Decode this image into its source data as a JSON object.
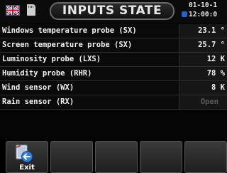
{
  "header": {
    "title": "INPUTS STATE",
    "date": "01-10-1",
    "time": "12:00:0"
  },
  "rows": [
    {
      "name": "Windows temperature probe (SX)",
      "value": "23.1 °",
      "enabled": true
    },
    {
      "name": "Screen temperature probe (SX)",
      "value": "25.7 °",
      "enabled": true
    },
    {
      "name": "Luminosity probe (LXS)",
      "value": "12 K",
      "enabled": true
    },
    {
      "name": "Humidity probe (RHR)",
      "value": "78 %",
      "enabled": true
    },
    {
      "name": "Wind sensor (WX)",
      "value": "8 K",
      "enabled": true
    },
    {
      "name": "Rain sensor (RX)",
      "value": "Open",
      "enabled": false
    }
  ],
  "footer": {
    "exit_label": "Exit"
  },
  "icons": {
    "flag": "uk-flag-icon",
    "storage": "sd-card-icon",
    "clock": "clock-icon",
    "exit": "exit-door-icon"
  }
}
